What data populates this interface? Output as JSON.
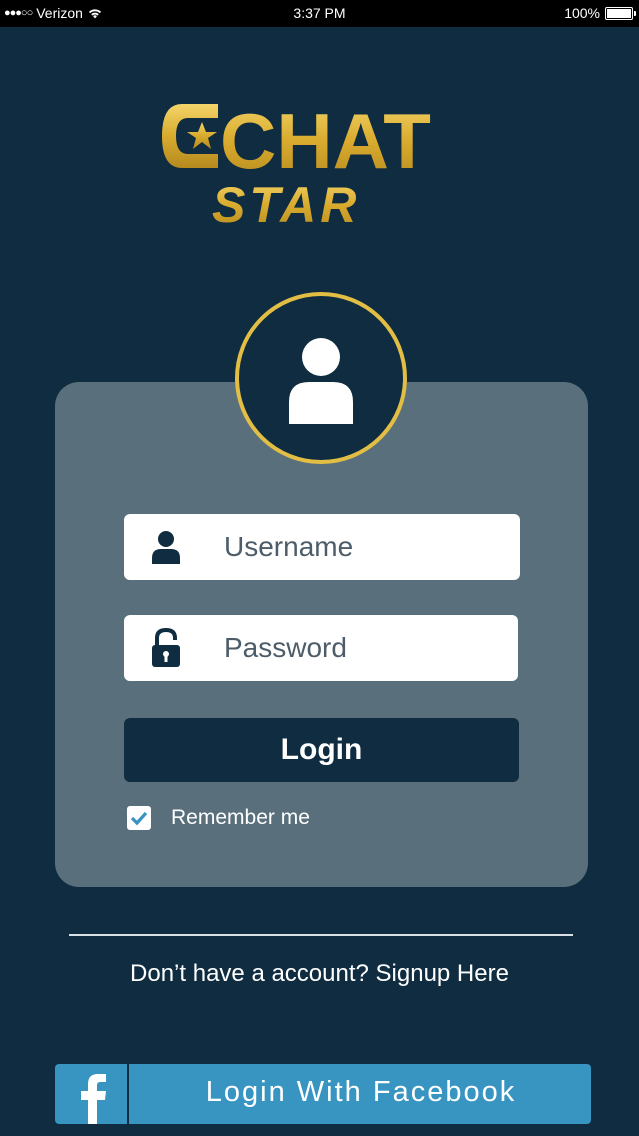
{
  "status_bar": {
    "signal": "●●●○○",
    "carrier": "Verizon",
    "time": "3:37 PM",
    "battery": "100%"
  },
  "logo": {
    "line1": "CHAT",
    "line2": "STAR",
    "color": "#d9b13a"
  },
  "form": {
    "username_placeholder": "Username",
    "password_placeholder": "Password",
    "login_label": "Login",
    "remember_label": "Remember me",
    "remember_checked": true
  },
  "signup_text": "Don’t have a account? Signup Here",
  "facebook": {
    "label": "Login With Facebook",
    "icon": "facebook-f-icon"
  },
  "colors": {
    "background": "#0f2c40",
    "card": "#59707c",
    "accent_gold": "#e3be45",
    "facebook_blue": "#3894c0"
  }
}
